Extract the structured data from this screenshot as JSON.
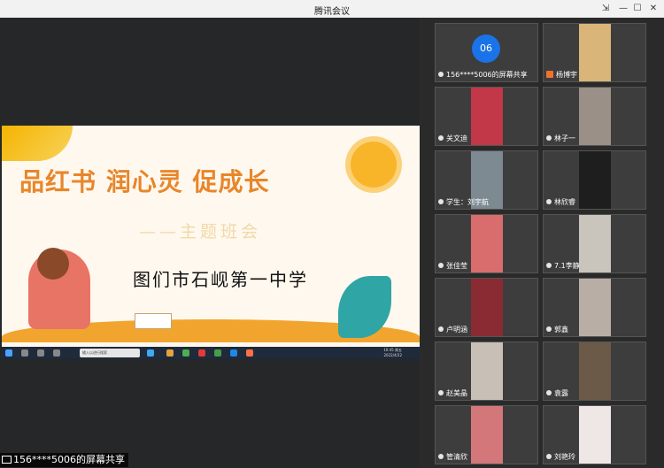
{
  "window": {
    "title": "腾讯会议",
    "controls": {
      "pin": "⇲",
      "minimize": "—",
      "maximize": "☐",
      "close": "✕"
    }
  },
  "share": {
    "label": "156****5006的屏幕共享"
  },
  "slide": {
    "title": "品红书 润心灵 促成长",
    "subtitle": "——主题班会",
    "school": "图们市石岘第一中学"
  },
  "taskbar": {
    "search": "输入以进行搜索",
    "clock_time": "10:45 周五",
    "clock_date": "2022/4/22"
  },
  "participants": [
    {
      "name": "156****5006的屏幕共享",
      "type": "avatar",
      "avatar_text": "06"
    },
    {
      "name": "杨博宇",
      "type": "video",
      "color": "#d9b57a"
    },
    {
      "name": "关文迪",
      "type": "video",
      "color": "#c23848"
    },
    {
      "name": "林子一",
      "type": "video",
      "color": "#9a9087"
    },
    {
      "name": "学生：刘宇航",
      "type": "video",
      "color": "#7d8a92"
    },
    {
      "name": "林欣睿",
      "type": "video",
      "color": "#1e1e1e"
    },
    {
      "name": "张佳莹",
      "type": "video",
      "color": "#d96d6d"
    },
    {
      "name": "7.1李静",
      "type": "video",
      "color": "#c9c4bc"
    },
    {
      "name": "卢明涵",
      "type": "video",
      "color": "#8a2a33"
    },
    {
      "name": "郭鑫",
      "type": "video",
      "color": "#b8aea6"
    },
    {
      "name": "赵美晶",
      "type": "video",
      "color": "#c8c0b6"
    },
    {
      "name": "袁露",
      "type": "video",
      "color": "#6b5a48"
    },
    {
      "name": "管清欣",
      "type": "video",
      "color": "#d4777a"
    },
    {
      "name": "刘艳玲",
      "type": "video",
      "color": "#efe6e6"
    }
  ]
}
